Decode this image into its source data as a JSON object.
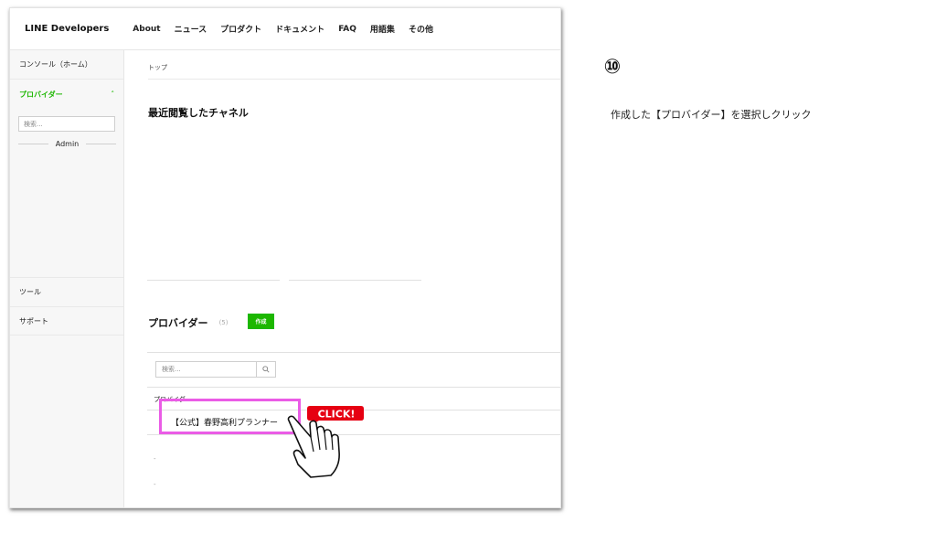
{
  "app": {
    "logo": "LINE Developers",
    "nav": [
      "About",
      "ニュース",
      "プロダクト",
      "ドキュメント",
      "FAQ",
      "用語集",
      "その他"
    ]
  },
  "sidebar": {
    "console_home": "コンソール（ホーム）",
    "providers_label": "プロバイダー",
    "caret": "˄",
    "search_placeholder": "検索...",
    "admin_label": "Admin",
    "tools": "ツール",
    "support": "サポート"
  },
  "main": {
    "breadcrumb": "トップ",
    "recent_heading": "最近閲覧したチャネル",
    "providers_heading": "プロバイダー",
    "providers_count": "(5)",
    "create_button": "作成",
    "search_placeholder": "検索...",
    "column_header": "プロバイダー",
    "provider_name": "【公式】春野高利プランナー",
    "dash1": "-",
    "dash2": "-"
  },
  "annotation": {
    "click_badge": "CLICK!",
    "step_number": "⑩",
    "instruction": "作成した【プロバイダー】を選択しクリック"
  },
  "colors": {
    "brand_green": "#1cb700",
    "highlight_pink": "#ea5ce6",
    "click_red": "#e60012"
  },
  "icons": [
    "search-icon",
    "pointing-hand-icon"
  ]
}
